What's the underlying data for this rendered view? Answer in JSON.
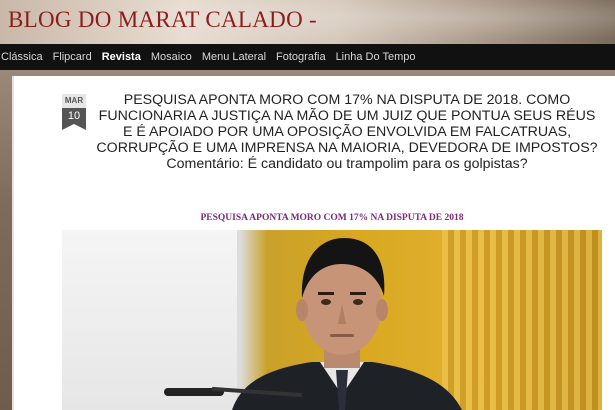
{
  "blog": {
    "title": "BLOG DO MARAT CALADO -"
  },
  "nav": {
    "items": [
      {
        "label": "Clássica",
        "active": false
      },
      {
        "label": "Flipcard",
        "active": false
      },
      {
        "label": "Revista",
        "active": true
      },
      {
        "label": "Mosaico",
        "active": false
      },
      {
        "label": "Menu Lateral",
        "active": false
      },
      {
        "label": "Fotografia",
        "active": false
      },
      {
        "label": "Linha Do Tempo",
        "active": false
      }
    ]
  },
  "post": {
    "date_month": "MAR",
    "date_day": "10",
    "title": "PESQUISA APONTA MORO COM 17% NA DISPUTA DE 2018. COMO FUNCIONARIA A JUSTIÇA NA MÃO DE UM JUIZ QUE PONTUA SEUS RÉUS E É APOIADO POR UMA OPOSIÇÃO ENVOLVIDA EM FALCATRUAS, CORRUPÇÃO E UMA IMPRENSA NA MAIORIA, DEVEDORA DE IMPOSTOS? Comentário: É candidato ou trampolim para os golpistas?",
    "subtitle": "PESQUISA APONTA MORO COM 17% NA DISPUTA DE 2018"
  },
  "colors": {
    "title_red": "#8c1d1d",
    "subtitle_purple": "#7a2a7a",
    "nav_bg": "#111111"
  }
}
